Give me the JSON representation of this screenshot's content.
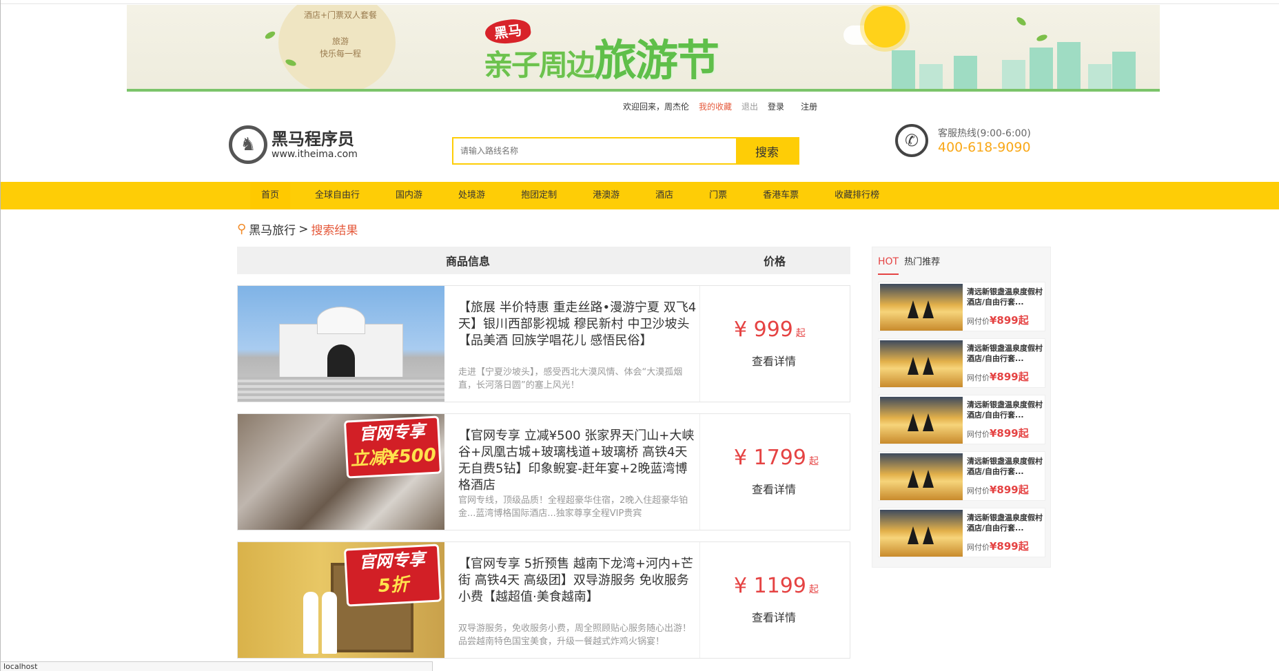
{
  "banner": {
    "promo_line1": "酒店+门票双人套餐",
    "promo_line2": "旅游",
    "promo_line3": "快乐每一程",
    "logo_chip": "黑马",
    "title_sub": "亲子周边",
    "title_main": "旅游节"
  },
  "userbar": {
    "welcome": "欢迎回来，周杰伦",
    "favorites": "我的收藏",
    "logout": "退出",
    "login": "登录",
    "register": "注册"
  },
  "header": {
    "logo_name": "黑马程序员",
    "logo_url": "www.itheima.com",
    "search_placeholder": "请输入路线名称",
    "search_button": "搜索",
    "hotline_label": "客服热线(9:00-6:00)",
    "hotline_number": "400-618-9090"
  },
  "nav": {
    "items": [
      "首页",
      "全球自由行",
      "国内游",
      "处境游",
      "抱团定制",
      "港澳游",
      "酒店",
      "门票",
      "香港车票",
      "收藏排行榜"
    ]
  },
  "breadcrumb": {
    "root": "黑马旅行",
    "sep": ">",
    "current": "搜索结果"
  },
  "results": {
    "col_info": "商品信息",
    "col_price": "价格",
    "items": [
      {
        "title": "【旅展 半价特惠 重走丝路•漫游宁夏 双飞4天】银川西部影视城 穆民新村 中卫沙坡头【品美酒 回族学唱花儿 感悟民俗】",
        "desc": "走进【宁夏沙坡头】，感受西北大漠风情、体会“大漠孤烟直，长河落日圆”的塞上风光！",
        "price": "¥ 999",
        "price_suffix": "起",
        "detail": "查看详情"
      },
      {
        "title": "【官网专享 立减¥500 张家界天门山+大峡谷+凤凰古城+玻璃栈道+玻璃桥 高铁4天 无自费5钻】印象鲵宴-赶年宴+2晚蓝湾博格酒店",
        "desc": "官网专线，顶级品质！全程超豪华住宿，2晚入住超豪华铂金...蓝湾博格国际酒店...独家尊享全程VIP贵宾",
        "price": "¥ 1799",
        "price_suffix": "起",
        "detail": "查看详情",
        "tag_l1": "官网专享",
        "tag_l2": "立减¥500"
      },
      {
        "title": "【官网专享 5折预售 越南下龙湾+河内+芒街 高铁4天 高级团】双导游服务 免收服务小费【越超值·美食越南】",
        "desc": "双导游服务，免收服务小费，周全照顾贴心服务随心出游！品尝越南特色国宝美食，升级一餐越式炸鸡火锅宴！",
        "price": "¥ 1199",
        "price_suffix": "起",
        "detail": "查看详情",
        "tag_l1": "官网专享",
        "tag_l2": "5折"
      }
    ]
  },
  "sidebar": {
    "hot": "HOT",
    "title": "热门推荐",
    "items": [
      {
        "title": "清远新银盏温泉度假村酒店/自由行套...",
        "price_label": "网付价",
        "price": "¥899起"
      },
      {
        "title": "清远新银盏温泉度假村酒店/自由行套...",
        "price_label": "网付价",
        "price": "¥899起"
      },
      {
        "title": "清远新银盏温泉度假村酒店/自由行套...",
        "price_label": "网付价",
        "price": "¥899起"
      },
      {
        "title": "清远新银盏温泉度假村酒店/自由行套...",
        "price_label": "网付价",
        "price": "¥899起"
      },
      {
        "title": "清远新银盏温泉度假村酒店/自由行套...",
        "price_label": "网付价",
        "price": "¥899起"
      }
    ]
  },
  "status": {
    "url": "localhost"
  },
  "colors": {
    "accent": "#fecd06",
    "price": "#e54343",
    "hotline": "#f9a818"
  }
}
